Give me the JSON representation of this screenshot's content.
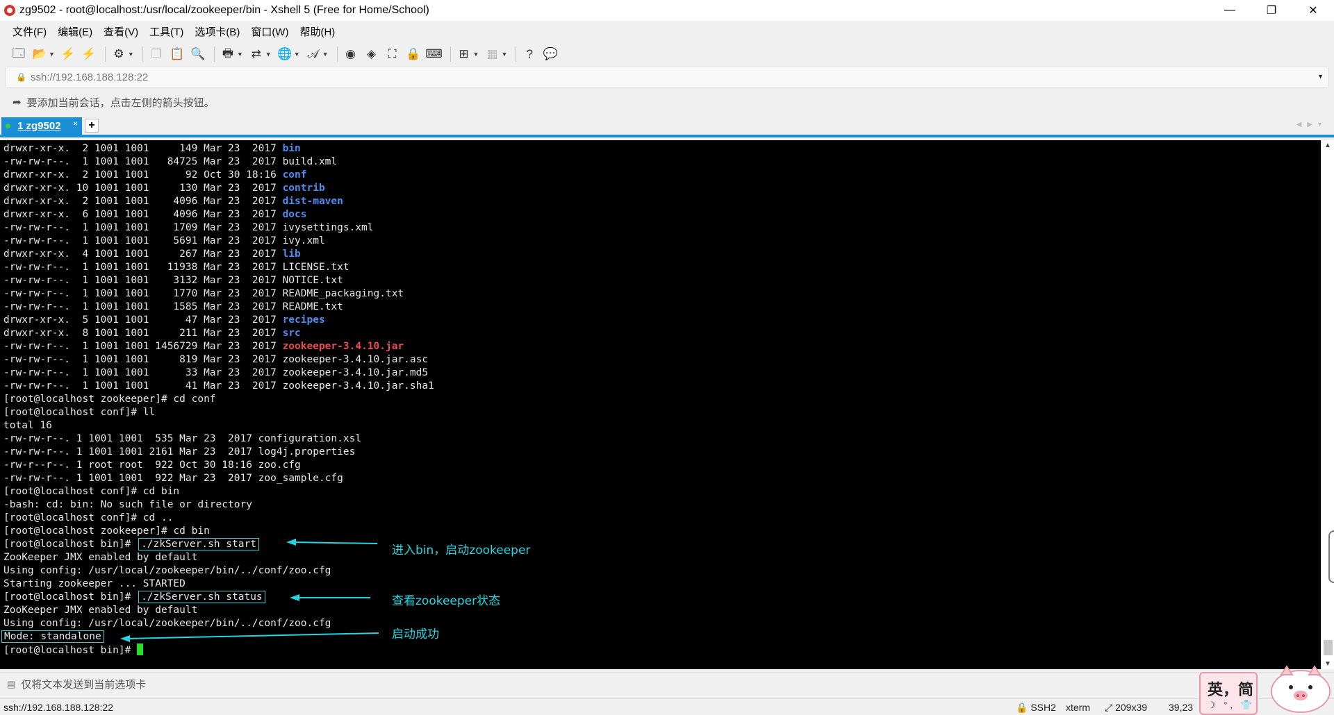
{
  "window": {
    "title": "zg9502 - root@localhost:/usr/local/zookeeper/bin - Xshell 5 (Free for Home/School)",
    "controls": [
      "—",
      "❐",
      "✕"
    ]
  },
  "menu": [
    "文件(F)",
    "编辑(E)",
    "查看(V)",
    "工具(T)",
    "选项卡(B)",
    "窗口(W)",
    "帮助(H)"
  ],
  "address": {
    "value": "ssh://192.168.188.128:22"
  },
  "hint": {
    "text": "要添加当前会话，点击左侧的箭头按钮。"
  },
  "tab": {
    "label": "1 zg9502",
    "close": "×",
    "add": "+"
  },
  "terminal": {
    "lines": [
      [
        {
          "t": "drwxr-xr-x.  2 1001 1001     149 Mar 23  2017 "
        },
        {
          "t": "bin",
          "c": "dir"
        }
      ],
      [
        {
          "t": "-rw-rw-r--.  1 1001 1001   84725 Mar 23  2017 build.xml"
        }
      ],
      [
        {
          "t": "drwxr-xr-x.  2 1001 1001      92 Oct 30 18:16 "
        },
        {
          "t": "conf",
          "c": "dir"
        }
      ],
      [
        {
          "t": "drwxr-xr-x. 10 1001 1001     130 Mar 23  2017 "
        },
        {
          "t": "contrib",
          "c": "dir"
        }
      ],
      [
        {
          "t": "drwxr-xr-x.  2 1001 1001    4096 Mar 23  2017 "
        },
        {
          "t": "dist-maven",
          "c": "dir"
        }
      ],
      [
        {
          "t": "drwxr-xr-x.  6 1001 1001    4096 Mar 23  2017 "
        },
        {
          "t": "docs",
          "c": "dir"
        }
      ],
      [
        {
          "t": "-rw-rw-r--.  1 1001 1001    1709 Mar 23  2017 ivysettings.xml"
        }
      ],
      [
        {
          "t": "-rw-rw-r--.  1 1001 1001    5691 Mar 23  2017 ivy.xml"
        }
      ],
      [
        {
          "t": "drwxr-xr-x.  4 1001 1001     267 Mar 23  2017 "
        },
        {
          "t": "lib",
          "c": "dir"
        }
      ],
      [
        {
          "t": "-rw-rw-r--.  1 1001 1001   11938 Mar 23  2017 LICENSE.txt"
        }
      ],
      [
        {
          "t": "-rw-rw-r--.  1 1001 1001    3132 Mar 23  2017 NOTICE.txt"
        }
      ],
      [
        {
          "t": "-rw-rw-r--.  1 1001 1001    1770 Mar 23  2017 README_packaging.txt"
        }
      ],
      [
        {
          "t": "-rw-rw-r--.  1 1001 1001    1585 Mar 23  2017 README.txt"
        }
      ],
      [
        {
          "t": "drwxr-xr-x.  5 1001 1001      47 Mar 23  2017 "
        },
        {
          "t": "recipes",
          "c": "dir"
        }
      ],
      [
        {
          "t": "drwxr-xr-x.  8 1001 1001     211 Mar 23  2017 "
        },
        {
          "t": "src",
          "c": "dir"
        }
      ],
      [
        {
          "t": "-rw-rw-r--.  1 1001 1001 1456729 Mar 23  2017 "
        },
        {
          "t": "zookeeper-3.4.10.jar",
          "c": "red"
        }
      ],
      [
        {
          "t": "-rw-rw-r--.  1 1001 1001     819 Mar 23  2017 zookeeper-3.4.10.jar.asc"
        }
      ],
      [
        {
          "t": "-rw-rw-r--.  1 1001 1001      33 Mar 23  2017 zookeeper-3.4.10.jar.md5"
        }
      ],
      [
        {
          "t": "-rw-rw-r--.  1 1001 1001      41 Mar 23  2017 zookeeper-3.4.10.jar.sha1"
        }
      ],
      [
        {
          "t": "[root@localhost zookeeper]# cd conf"
        }
      ],
      [
        {
          "t": "[root@localhost conf]# ll"
        }
      ],
      [
        {
          "t": "total 16"
        }
      ],
      [
        {
          "t": "-rw-rw-r--. 1 1001 1001  535 Mar 23  2017 configuration.xsl"
        }
      ],
      [
        {
          "t": "-rw-rw-r--. 1 1001 1001 2161 Mar 23  2017 log4j.properties"
        }
      ],
      [
        {
          "t": "-rw-r--r--. 1 root root  922 Oct 30 18:16 zoo.cfg"
        }
      ],
      [
        {
          "t": "-rw-rw-r--. 1 1001 1001  922 Mar 23  2017 zoo_sample.cfg"
        }
      ],
      [
        {
          "t": "[root@localhost conf]# cd bin"
        }
      ],
      [
        {
          "t": "-bash: cd: bin: No such file or directory"
        }
      ],
      [
        {
          "t": "[root@localhost conf]# cd .."
        }
      ],
      [
        {
          "t": "[root@localhost zookeeper]# cd bin"
        }
      ],
      [
        {
          "t": "[root@localhost bin]# "
        },
        {
          "t": "./zkServer.sh start",
          "c": "box"
        }
      ],
      [
        {
          "t": "ZooKeeper JMX enabled by default"
        }
      ],
      [
        {
          "t": "Using config: /usr/local/zookeeper/bin/../conf/zoo.cfg"
        }
      ],
      [
        {
          "t": "Starting zookeeper ... STARTED"
        }
      ],
      [
        {
          "t": "[root@localhost bin]# "
        },
        {
          "t": "./zkServer.sh status",
          "c": "box"
        }
      ],
      [
        {
          "t": "ZooKeeper JMX enabled by default"
        }
      ],
      [
        {
          "t": "Using config: /usr/local/zookeeper/bin/../conf/zoo.cfg"
        }
      ],
      [
        {
          "t": "Mode: standalone",
          "c": "box0"
        }
      ],
      [
        {
          "t": "[root@localhost bin]# "
        },
        {
          "t": "",
          "c": "cursor"
        }
      ]
    ]
  },
  "annotations": {
    "start": "进入bin，启动zookeeper",
    "status": "查看zookeeper状态",
    "success": "启动成功"
  },
  "send": {
    "text": "仅将文本发送到当前选项卡"
  },
  "status": {
    "url": "ssh://192.168.188.128:22",
    "protocol": "SSH2",
    "term": "xterm",
    "size": "209x39",
    "pos": "39,23"
  },
  "ime": {
    "label": "英，简",
    "sub": "☽ °, 👕"
  },
  "colors": {
    "accent": "#1b8fd6",
    "dir": "#4d8cf0",
    "jar": "#ef4b4b",
    "annotation": "#22d6e0",
    "cursor": "#26e026"
  }
}
